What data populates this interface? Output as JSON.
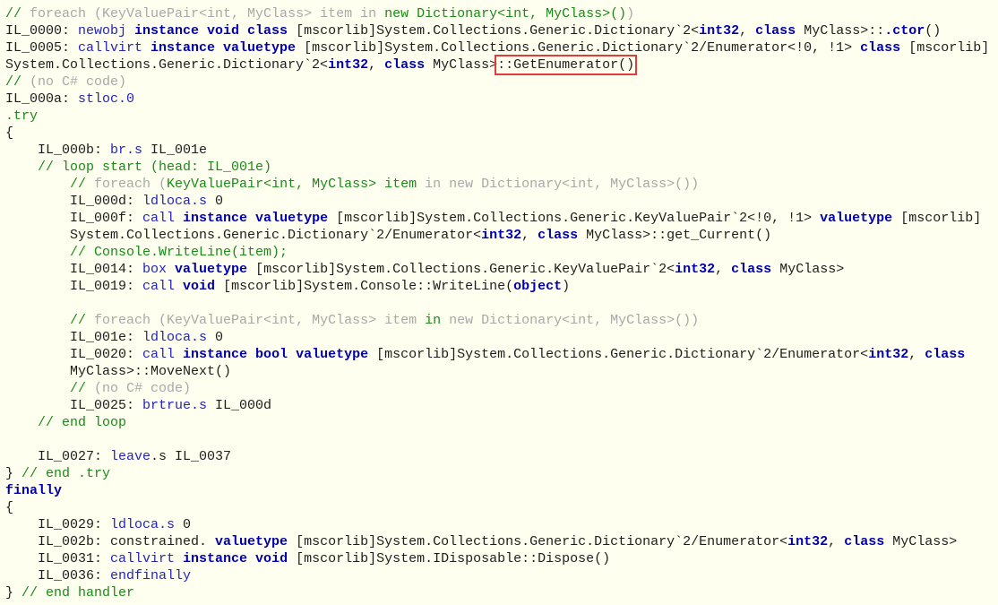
{
  "colors": {
    "background": "#fffff0",
    "comment": "#1a8a1a",
    "grey_comment": "#a8a8a8",
    "opcode": "#2525b8",
    "keyword": "#0000b0",
    "highlight_box": "#e03c3c"
  },
  "code": {
    "lines": [
      [
        {
          "s": "c",
          "t": "// "
        },
        {
          "s": "g",
          "t": "foreach (KeyValuePair<int, MyClass> item in "
        },
        {
          "s": "c",
          "t": "new Dictionary<int, MyClass>()"
        },
        {
          "s": "g",
          "t": ")"
        }
      ],
      [
        {
          "s": "t",
          "t": "IL_0000: "
        },
        {
          "s": "o",
          "t": "newobj "
        },
        {
          "s": "k",
          "t": "instance void class "
        },
        {
          "s": "t",
          "t": "[mscorlib]System.Collections.Generic.Dictionary`2<"
        },
        {
          "s": "k",
          "t": "int32"
        },
        {
          "s": "t",
          "t": ", "
        },
        {
          "s": "k",
          "t": "class "
        },
        {
          "s": "t",
          "t": "MyClass>::"
        },
        {
          "s": "k",
          "t": ".ctor"
        },
        {
          "s": "t",
          "t": "()"
        }
      ],
      [
        {
          "s": "t",
          "t": "IL_0005: "
        },
        {
          "s": "o",
          "t": "callvirt "
        },
        {
          "s": "k",
          "t": "instance valuetype "
        },
        {
          "s": "t",
          "t": "[mscorlib]System.Collections.Generic.Dictionary`2/Enumerator<!0, !1> "
        },
        {
          "s": "k",
          "t": "class "
        },
        {
          "s": "t",
          "t": "[mscorlib]"
        }
      ],
      [
        {
          "s": "t",
          "t": "System.Collections.Generic.Dictionary`2<"
        },
        {
          "s": "k",
          "t": "int32"
        },
        {
          "s": "t",
          "t": ", "
        },
        {
          "s": "k",
          "t": "class "
        },
        {
          "s": "t",
          "t": "MyClass>"
        },
        {
          "s": "t",
          "t": "::GetEnumerator()",
          "hl": true
        }
      ],
      [
        {
          "s": "c",
          "t": "// "
        },
        {
          "s": "g",
          "t": "(no C# code)"
        }
      ],
      [
        {
          "s": "t",
          "t": "IL_000a: "
        },
        {
          "s": "o",
          "t": "stloc.0"
        }
      ],
      [
        {
          "s": "c",
          "t": ".try"
        }
      ],
      [
        {
          "s": "t",
          "t": "{"
        }
      ],
      [
        {
          "s": "t",
          "t": "    IL_000b: "
        },
        {
          "s": "o",
          "t": "br.s "
        },
        {
          "s": "t",
          "t": "IL_001e"
        }
      ],
      [
        {
          "s": "c",
          "t": "    // loop start (head: IL_001e)"
        }
      ],
      [
        {
          "s": "c",
          "t": "        // "
        },
        {
          "s": "g",
          "t": "foreach ("
        },
        {
          "s": "c",
          "t": "KeyValuePair<int, MyClass> item"
        },
        {
          "s": "g",
          "t": " in new Dictionary<int, MyClass>())"
        }
      ],
      [
        {
          "s": "t",
          "t": "        IL_000d: "
        },
        {
          "s": "o",
          "t": "ldloca.s "
        },
        {
          "s": "t",
          "t": "0"
        }
      ],
      [
        {
          "s": "t",
          "t": "        IL_000f: "
        },
        {
          "s": "o",
          "t": "call "
        },
        {
          "s": "k",
          "t": "instance valuetype "
        },
        {
          "s": "t",
          "t": "[mscorlib]System.Collections.Generic.KeyValuePair`2<!0, !1> "
        },
        {
          "s": "k",
          "t": "valuetype "
        },
        {
          "s": "t",
          "t": "[mscorlib]"
        }
      ],
      [
        {
          "s": "t",
          "t": "        System.Collections.Generic.Dictionary`2/Enumerator<"
        },
        {
          "s": "k",
          "t": "int32"
        },
        {
          "s": "t",
          "t": ", "
        },
        {
          "s": "k",
          "t": "class "
        },
        {
          "s": "t",
          "t": "MyClass>::get_Current()"
        }
      ],
      [
        {
          "s": "c",
          "t": "        // Console.WriteLine(item);"
        }
      ],
      [
        {
          "s": "t",
          "t": "        IL_0014: "
        },
        {
          "s": "o",
          "t": "box "
        },
        {
          "s": "k",
          "t": "valuetype "
        },
        {
          "s": "t",
          "t": "[mscorlib]System.Collections.Generic.KeyValuePair`2<"
        },
        {
          "s": "k",
          "t": "int32"
        },
        {
          "s": "t",
          "t": ", "
        },
        {
          "s": "k",
          "t": "class "
        },
        {
          "s": "t",
          "t": "MyClass>"
        }
      ],
      [
        {
          "s": "t",
          "t": "        IL_0019: "
        },
        {
          "s": "o",
          "t": "call "
        },
        {
          "s": "k",
          "t": "void "
        },
        {
          "s": "t",
          "t": "[mscorlib]System.Console::WriteLine("
        },
        {
          "s": "k",
          "t": "object"
        },
        {
          "s": "t",
          "t": ")"
        }
      ],
      [],
      [
        {
          "s": "c",
          "t": "        // "
        },
        {
          "s": "g",
          "t": "foreach (KeyValuePair<int, MyClass> item "
        },
        {
          "s": "c",
          "t": "in"
        },
        {
          "s": "g",
          "t": " new Dictionary<int, MyClass>())"
        }
      ],
      [
        {
          "s": "t",
          "t": "        IL_001e: "
        },
        {
          "s": "o",
          "t": "ldloca.s "
        },
        {
          "s": "t",
          "t": "0"
        }
      ],
      [
        {
          "s": "t",
          "t": "        IL_0020: "
        },
        {
          "s": "o",
          "t": "call "
        },
        {
          "s": "k",
          "t": "instance bool valuetype "
        },
        {
          "s": "t",
          "t": "[mscorlib]System.Collections.Generic.Dictionary`2/Enumerator<"
        },
        {
          "s": "k",
          "t": "int32"
        },
        {
          "s": "t",
          "t": ", "
        },
        {
          "s": "k",
          "t": "class"
        }
      ],
      [
        {
          "s": "t",
          "t": "        MyClass>::MoveNext()"
        }
      ],
      [
        {
          "s": "c",
          "t": "        // "
        },
        {
          "s": "g",
          "t": "(no C# code)"
        }
      ],
      [
        {
          "s": "t",
          "t": "        IL_0025: "
        },
        {
          "s": "o",
          "t": "brtrue.s "
        },
        {
          "s": "t",
          "t": "IL_000d"
        }
      ],
      [
        {
          "s": "c",
          "t": "    // end loop"
        }
      ],
      [],
      [
        {
          "s": "t",
          "t": "    IL_0027: "
        },
        {
          "s": "o",
          "t": "leave"
        },
        {
          "s": "t",
          "t": ".s IL_0037"
        }
      ],
      [
        {
          "s": "t",
          "t": "} "
        },
        {
          "s": "c",
          "t": "// end .try"
        }
      ],
      [
        {
          "s": "k",
          "t": "finally"
        }
      ],
      [
        {
          "s": "t",
          "t": "{"
        }
      ],
      [
        {
          "s": "t",
          "t": "    IL_0029: "
        },
        {
          "s": "o",
          "t": "ldloca.s "
        },
        {
          "s": "t",
          "t": "0"
        }
      ],
      [
        {
          "s": "t",
          "t": "    IL_002b: constrained. "
        },
        {
          "s": "k",
          "t": "valuetype "
        },
        {
          "s": "t",
          "t": "[mscorlib]System.Collections.Generic.Dictionary`2/Enumerator<"
        },
        {
          "s": "k",
          "t": "int32"
        },
        {
          "s": "t",
          "t": ", "
        },
        {
          "s": "k",
          "t": "class "
        },
        {
          "s": "t",
          "t": "MyClass>"
        }
      ],
      [
        {
          "s": "t",
          "t": "    IL_0031: "
        },
        {
          "s": "o",
          "t": "callvirt "
        },
        {
          "s": "k",
          "t": "instance void "
        },
        {
          "s": "t",
          "t": "[mscorlib]System.IDisposable::Dispose()"
        }
      ],
      [
        {
          "s": "t",
          "t": "    IL_0036: "
        },
        {
          "s": "o",
          "t": "endfinally"
        }
      ],
      [
        {
          "s": "t",
          "t": "} "
        },
        {
          "s": "c",
          "t": "// end handler"
        }
      ]
    ]
  }
}
